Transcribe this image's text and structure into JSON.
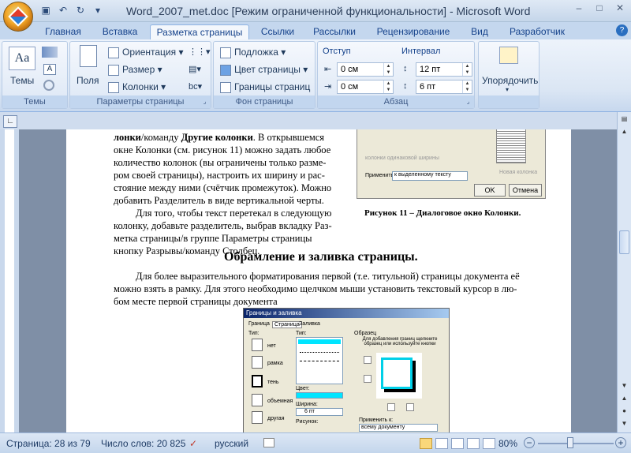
{
  "window": {
    "title": "Word_2007_met.doc [Режим ограниченной функциональности] - Microsoft Word",
    "controls": [
      "–",
      "□",
      "✕"
    ]
  },
  "tabs": [
    "Главная",
    "Вставка",
    "Разметка страницы",
    "Ссылки",
    "Рассылки",
    "Рецензирование",
    "Вид",
    "Разработчик"
  ],
  "active_tab": "Разметка страницы",
  "ribbon": {
    "themes": {
      "button": "Темы",
      "group": "Темы"
    },
    "page_setup": {
      "fields": "Поля",
      "orientation": "Ориентация",
      "size": "Размер",
      "columns": "Колонки",
      "group": "Параметры страницы"
    },
    "background": {
      "watermark": "Подложка",
      "page_color": "Цвет страницы",
      "page_borders": "Границы страниц",
      "group": "Фон страницы"
    },
    "paragraph": {
      "indent_label": "Отступ",
      "spacing_label": "Интервал",
      "indent_left": "0 см",
      "indent_right": "0 см",
      "spacing_before": "12 пт",
      "spacing_after": "6 пт",
      "group": "Абзац"
    },
    "arrange": {
      "button": "Упорядочить"
    }
  },
  "document": {
    "para1": [
      {
        "b": "лонки",
        "t": "/команду "
      },
      {
        "b": "Другие колонки",
        "t": ". В открывшемся"
      }
    ],
    "para1_lines": [
      "окне Колонки (см. рисунок 11) можно задать любое",
      "количество колонок (вы ограничены только разме-",
      "ром своей страницы), настроить их ширину и рас-",
      "стояние между ними (счётчик промежуток). Можно",
      "добавить Разделитель в виде вертикальной черты."
    ],
    "para2_lines": [
      "Для того, чтобы текст перетекал в следующую",
      "колонку, добавьте разделитель, выбрав вкладку Раз-",
      "метка страницы/в группе Параметры страницы",
      "кнопку Разрывы/команду Столбец."
    ],
    "fig11_caption": "Рисунок 11 – Диалоговое окно Колонки.",
    "fig11": {
      "equal": "колонки одинаковой ширины",
      "apply": "Применить:",
      "apply_value": "к выделенному тексту",
      "new_col": "Новая колонка",
      "ok": "OK",
      "cancel": "Отмена"
    },
    "heading": "Обрамление и заливка страницы.",
    "para3_lines": [
      "Для более выразительного форматирования первой (т.е. титульной) страницы документа её",
      "можно взять в рамку. Для этого необходимо щелчком мыши установить текстовый курсор в лю-",
      "бом месте первой страницы документа"
    ],
    "fig2": {
      "title": "Границы и заливка",
      "tabs": [
        "Граница",
        "Страница",
        "Заливка"
      ],
      "type": "Тип:",
      "types": [
        "нет",
        "рамка",
        "тень",
        "объемная",
        "другая"
      ],
      "line_type": "Тип:",
      "color": "Цвет:",
      "width": "Ширина:",
      "width_value": "6 пт",
      "pattern": "Рисунок:",
      "sample": "Образец",
      "hint": "Для добавления границ щелкните образец или используйте кнопки",
      "apply": "Применить к:",
      "apply_value": "всему документу"
    }
  },
  "status": {
    "page": "Страница: 28 из 79",
    "words": "Число слов: 20 825",
    "lang": "русский",
    "zoom": "80%",
    "zoom_level": 0.8
  }
}
